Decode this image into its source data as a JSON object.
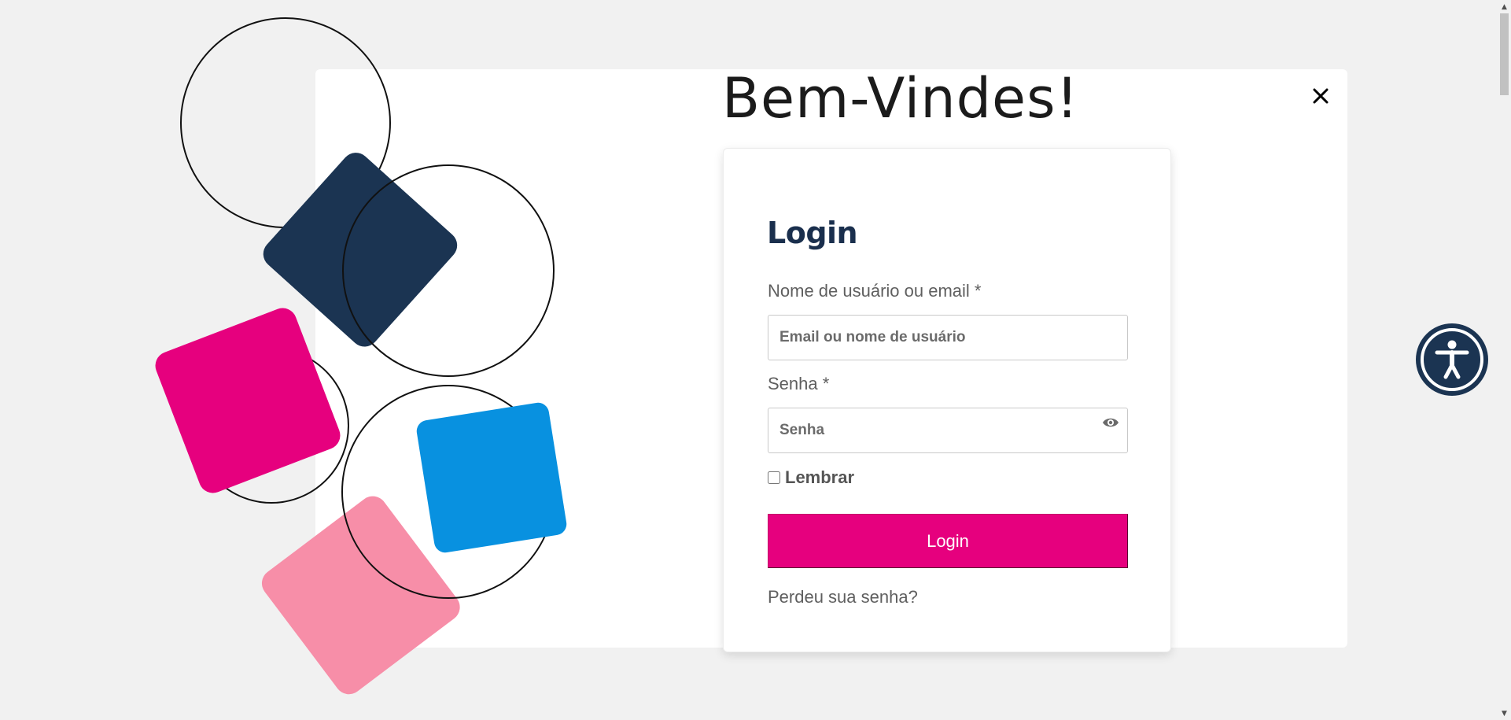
{
  "modal": {
    "title": "Bem-Vindes!",
    "close_icon": "close-icon"
  },
  "login_form": {
    "heading": "Login",
    "username_label": "Nome de usuário ou email *",
    "username_placeholder": "Email ou nome de usuário",
    "password_label": "Senha *",
    "password_placeholder": "Senha",
    "password_toggle_icon": "eye-icon",
    "remember_label": "Lembrar",
    "remember_checked": false,
    "submit_label": "Login",
    "lost_password_link": "Perdeu sua senha?"
  },
  "accessibility_widget": {
    "icon": "accessibility-icon"
  },
  "colors": {
    "navy": "#1b3452",
    "magenta": "#e6007e",
    "blue": "#0891e0",
    "pink": "#f78ea8",
    "background": "#f1f1f1"
  }
}
